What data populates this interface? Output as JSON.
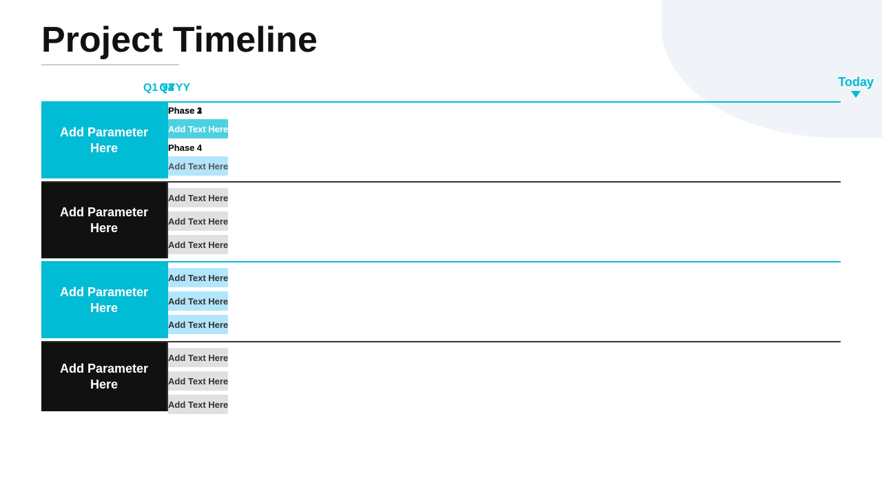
{
  "title": "Project Timeline",
  "title_underline": true,
  "quarters": [
    {
      "label": "Q3",
      "left_pct": 14
    },
    {
      "label": "Q4",
      "left_pct": 28
    },
    {
      "label": "Q1 YYYY",
      "left_pct": 45
    },
    {
      "label": "Q2",
      "left_pct": 62
    },
    {
      "label": "Q3",
      "left_pct": 79
    }
  ],
  "today": "Today",
  "sections": [
    {
      "id": "section-1",
      "type": "blue",
      "label": "Add Parameter Here",
      "phase_headers": [
        {
          "text": "Phase 1",
          "left_pct": 45
        },
        {
          "text": "Phase 2",
          "left_pct": 60
        },
        {
          "text": "Phase 3",
          "left_pct": 76
        },
        {
          "text": "Phase 4",
          "left_pct": 38,
          "row": 2
        },
        {
          "text": "Phase 4",
          "left_pct": 60,
          "row": 2
        }
      ],
      "bars": [
        {
          "row": 1,
          "text": "Add Text Here",
          "left_pct": 14,
          "width_pct": 28,
          "type": "arrow-blue"
        },
        {
          "row": 1,
          "text": "Add Text Here",
          "left_pct": 45,
          "width_pct": 33,
          "type": "blue-medium"
        },
        {
          "row": 2,
          "text": "Add Text Here",
          "left_pct": 25,
          "width_pct": 24,
          "type": "blue-light"
        },
        {
          "row": 2,
          "text": "Add Text Here",
          "left_pct": 60,
          "width_pct": 33,
          "type": "arrow-blue"
        }
      ]
    },
    {
      "id": "section-2",
      "type": "black",
      "label": "Add Parameter Here",
      "bars": [
        {
          "row": 1,
          "text": "Add Text Here",
          "left_pct": 10,
          "width_pct": 28,
          "type": "arrow-gray"
        },
        {
          "row": 1,
          "text": "Add Text Here",
          "left_pct": 44,
          "width_pct": 19,
          "type": "gray-light"
        },
        {
          "row": 2,
          "text": "Add Text Here",
          "left_pct": 18,
          "width_pct": 22,
          "type": "gray-light"
        },
        {
          "row": 2,
          "text": "Add Text Here",
          "left_pct": 64,
          "width_pct": 22,
          "type": "gray-light"
        },
        {
          "row": 3,
          "text": "Add Text Here",
          "left_pct": 30,
          "width_pct": 24,
          "type": "gray-light"
        },
        {
          "row": 3,
          "text": "Add Text Here",
          "left_pct": 56,
          "width_pct": 22,
          "type": "gray-light"
        }
      ]
    },
    {
      "id": "section-3",
      "type": "blue",
      "label": "Add Parameter Here",
      "bars": [
        {
          "row": 1,
          "text": "Add Text Here",
          "left_pct": 24,
          "width_pct": 26,
          "type": "blue-light"
        },
        {
          "row": 1,
          "text": "Add Text Here",
          "left_pct": 60,
          "width_pct": 20,
          "type": "blue-light"
        },
        {
          "row": 2,
          "text": "Add Text Here",
          "left_pct": 38,
          "width_pct": 22,
          "type": "blue-light"
        },
        {
          "row": 2,
          "text": "Add Text Here",
          "left_pct": 63,
          "width_pct": 22,
          "type": "blue-light"
        },
        {
          "row": 3,
          "text": "Add Text Here",
          "left_pct": 14,
          "width_pct": 24,
          "type": "blue-light"
        },
        {
          "row": 3,
          "text": "Add Text Here",
          "left_pct": 65,
          "width_pct": 22,
          "type": "blue-light"
        }
      ]
    },
    {
      "id": "section-4",
      "type": "black",
      "label": "Add Parameter Here",
      "bars": [
        {
          "row": 1,
          "text": "Add Text Here",
          "left_pct": 58,
          "width_pct": 18,
          "type": "gray-light"
        },
        {
          "row": 2,
          "text": "Add Text Here",
          "left_pct": 34,
          "width_pct": 22,
          "type": "gray-light"
        },
        {
          "row": 2,
          "text": "Add Text Here",
          "left_pct": 62,
          "width_pct": 22,
          "type": "gray-light"
        },
        {
          "row": 3,
          "text": "Add Text Here",
          "left_pct": 18,
          "width_pct": 24,
          "type": "gray-light"
        }
      ]
    }
  ],
  "bar_label": "Add Text Here"
}
